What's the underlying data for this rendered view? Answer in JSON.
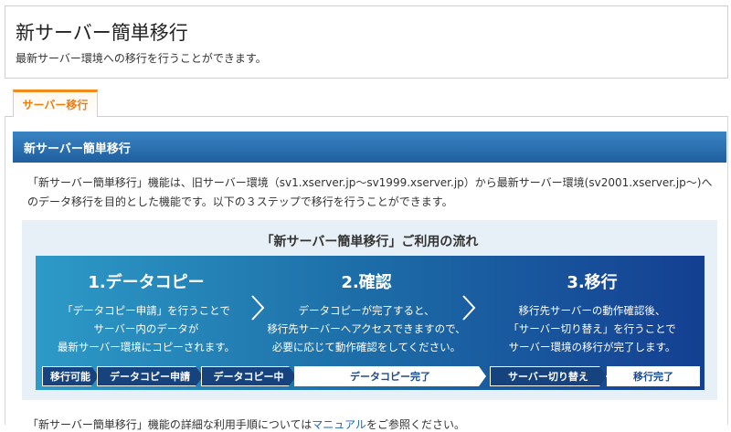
{
  "header": {
    "title": "新サーバー簡単移行",
    "subtitle": "最新サーバー環境への移行を行うことができます。"
  },
  "tabs": [
    {
      "label": "サーバー移行",
      "active": true
    }
  ],
  "section": {
    "heading": "新サーバー簡単移行",
    "description_line1": "「新サーバー簡単移行」機能は、旧サーバー環境（sv1.xserver.jp〜sv1999.xserver.jp）から最新サーバー環境(sv2001.xserver.jp〜)へ",
    "description_line2": "のデータ移行を目的とした機能です。以下の３ステップで移行を行うことができます。"
  },
  "flow": {
    "title": "「新サーバー簡単移行」ご利用の流れ",
    "steps": [
      {
        "title": "1.データコピー",
        "lines": [
          "「データコピー申請」を行うことで",
          "サーバー内のデータが",
          "最新サーバー環境にコピーされます。"
        ]
      },
      {
        "title": "2.確認",
        "lines": [
          "データコピーが完了すると、",
          "移行先サーバーへアクセスできますので、",
          "必要に応じて動作確認をしてください。"
        ]
      },
      {
        "title": "3.移行",
        "lines": [
          "移行先サーバーの動作確認後、",
          "「サーバー切り替え」を行うことで",
          "サーバー環境の移行が完了します。"
        ]
      }
    ],
    "statuses": [
      "移行可能",
      "データコピー申請",
      "データコピー中",
      "データコピー完了",
      "サーバー切り替え",
      "移行完了"
    ]
  },
  "footer": {
    "text_before": "「新サーバー簡単移行」機能の詳細な利用手順については",
    "link": "マニュアル",
    "text_after": "をご参照ください。"
  },
  "colors": {
    "accent_orange": "#ee7d10",
    "section_blue": "#1f5f9e",
    "link_blue": "#1f65b5"
  }
}
